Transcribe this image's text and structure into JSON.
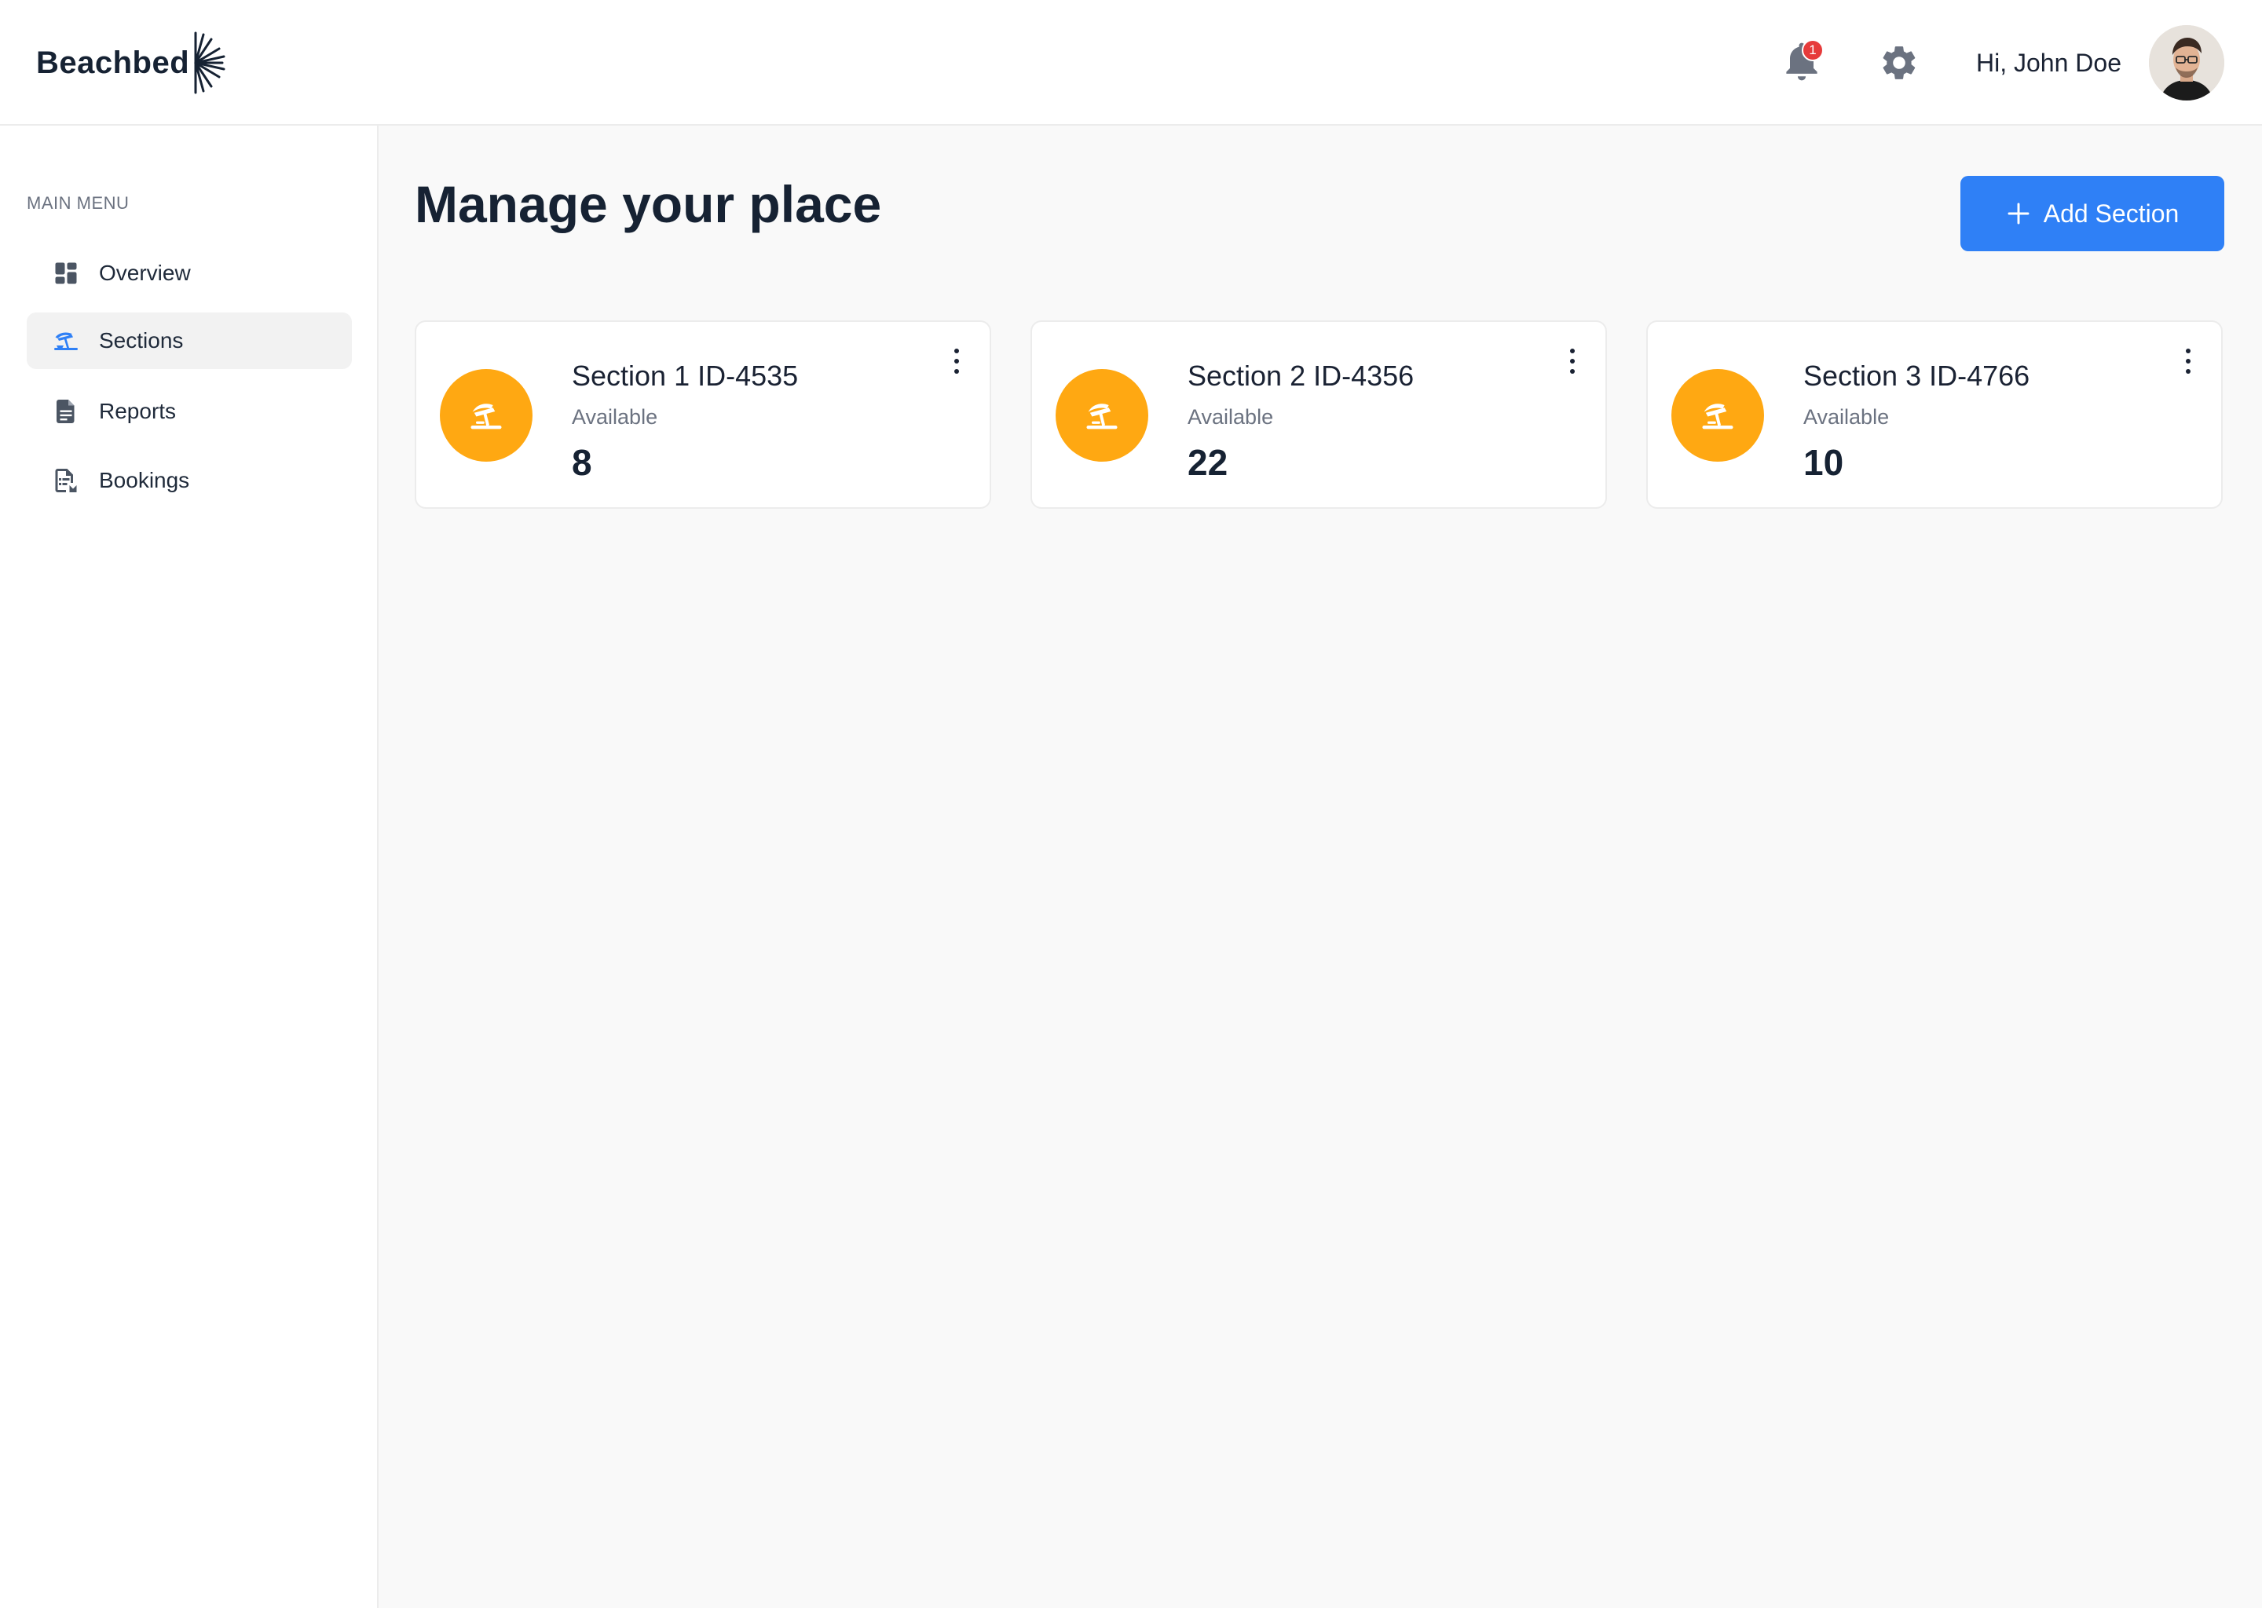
{
  "brand": {
    "name": "Beachbed"
  },
  "header": {
    "notifications_count": "1",
    "greeting": "Hi, John Doe"
  },
  "sidebar": {
    "menu_title": "MAIN MENU",
    "items": [
      {
        "label": "Overview",
        "icon": "dashboard-icon"
      },
      {
        "label": "Sections",
        "icon": "beach-umbrella-icon",
        "active": true
      },
      {
        "label": "Reports",
        "icon": "document-icon"
      },
      {
        "label": "Bookings",
        "icon": "booking-list-icon"
      }
    ]
  },
  "main": {
    "title": "Manage your place",
    "add_button_label": "Add Section",
    "cards": [
      {
        "title": "Section 1 ID-4535",
        "subtitle": "Available",
        "count": "8"
      },
      {
        "title": "Section 2 ID-4356",
        "subtitle": "Available",
        "count": "22"
      },
      {
        "title": "Section 3 ID-4766",
        "subtitle": "Available",
        "count": "10"
      }
    ]
  },
  "colors": {
    "accent": "#2f80f6",
    "card_icon_bg": "#ffa812",
    "badge": "#e63b3b"
  }
}
